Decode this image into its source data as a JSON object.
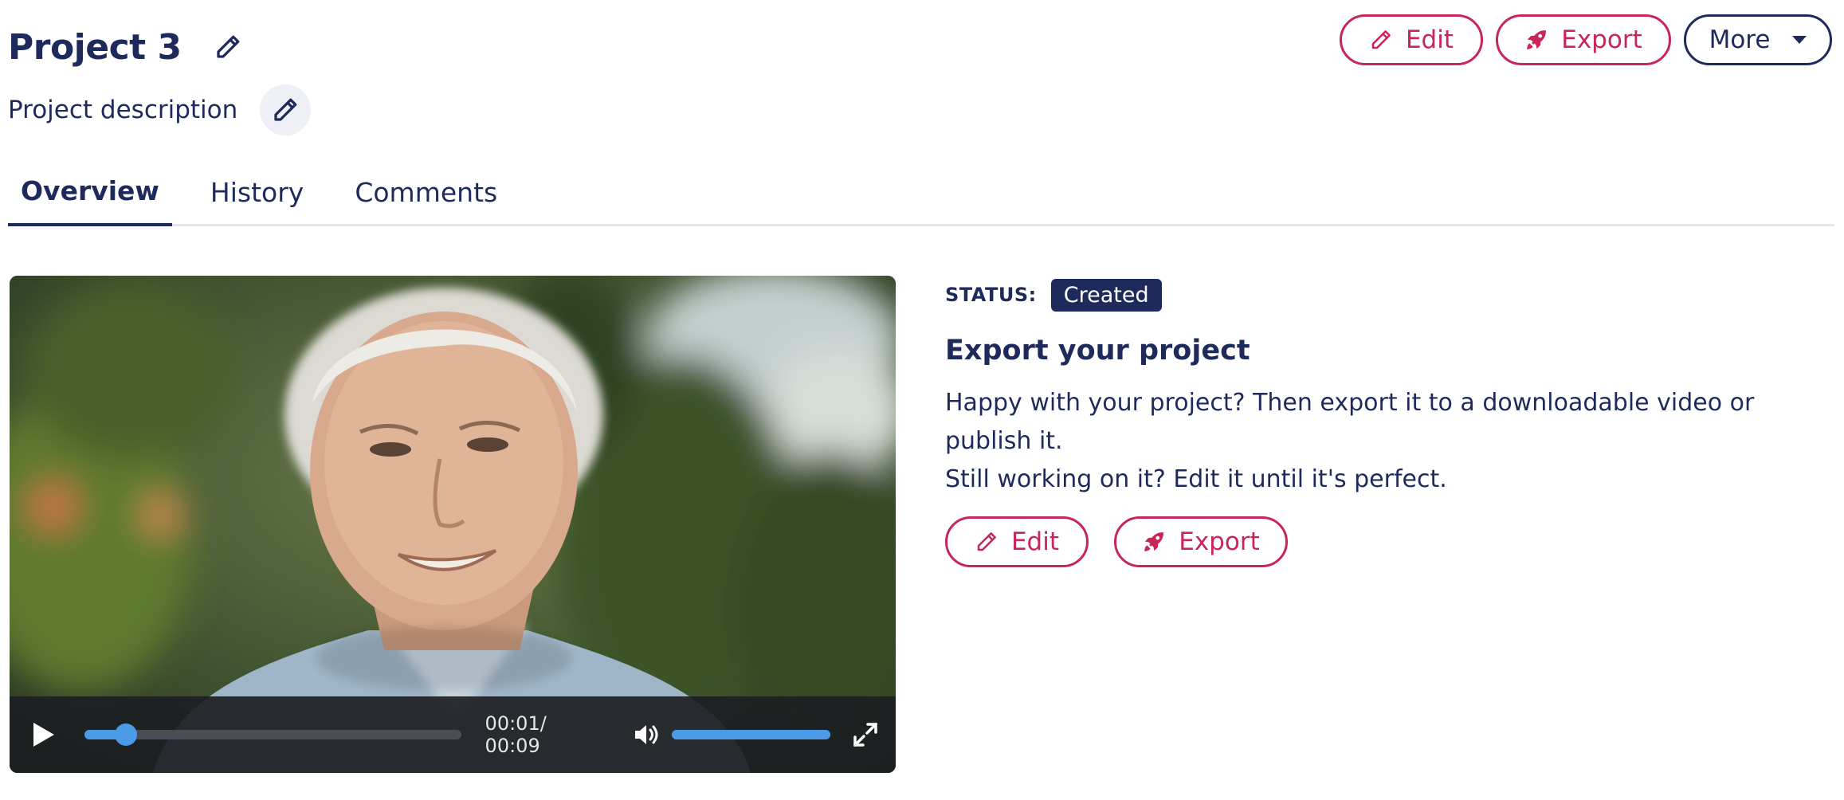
{
  "project": {
    "title": "Project 3",
    "description": "Project description"
  },
  "top_actions": {
    "edit_label": "Edit",
    "export_label": "Export",
    "more_label": "More"
  },
  "tabs": [
    {
      "label": "Overview",
      "active": true
    },
    {
      "label": "History",
      "active": false
    },
    {
      "label": "Comments",
      "active": false
    }
  ],
  "video": {
    "time_display": "00:01/ 00:09",
    "progress": 0.11,
    "volume": 1.0
  },
  "status": {
    "label": "STATUS:",
    "value": "Created"
  },
  "export_panel": {
    "title": "Export your project",
    "text_line1": "Happy with your project? Then export it to a downloadable video or publish it.",
    "text_line2": "Still working on it? Edit it until it's perfect.",
    "edit_label": "Edit",
    "export_label": "Export"
  },
  "colors": {
    "navy": "#1f2a5c",
    "accent": "#c82558",
    "player_blue": "#4b9be8"
  },
  "icons": [
    "pencil-icon",
    "rocket-icon",
    "chevron-down-icon",
    "play-icon",
    "volume-icon",
    "fullscreen-icon"
  ]
}
